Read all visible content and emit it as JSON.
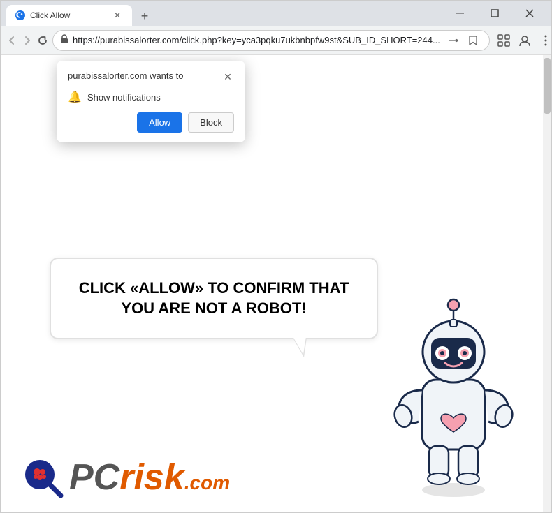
{
  "window": {
    "title": "Click Allow",
    "minimize": "─",
    "maximize": "□",
    "close": "✕"
  },
  "tab": {
    "label": "Click Allow",
    "close": "✕"
  },
  "new_tab_button": "+",
  "address_bar": {
    "url": "https://purabissalorter.com/click.php?key=yca3pqku7ukbnbpfw9st&SUB_ID_SHORT=244...",
    "lock_icon": "🔒",
    "back_disabled": true,
    "forward_disabled": true
  },
  "notification_popup": {
    "title": "purabissalorter.com wants to",
    "close": "✕",
    "notification_text": "Show notifications",
    "allow_button": "Allow",
    "block_button": "Block"
  },
  "main_content": {
    "speech_bubble_text": "CLICK «ALLOW» TO CONFIRM THAT YOU ARE NOT A ROBOT!"
  },
  "pcrisk": {
    "pc_text": "PC",
    "risk_com_text": "risk.com"
  },
  "colors": {
    "allow_button": "#1a73e8",
    "block_button": "#f8f8f8",
    "accent_orange": "#e05a00",
    "robot_dark": "#1a2a4a",
    "robot_pink": "#f5a0b0",
    "robot_white": "#f0f4f8"
  }
}
